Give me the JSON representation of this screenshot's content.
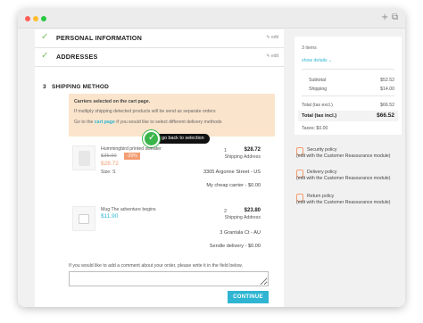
{
  "window": {
    "plus_icon": "+",
    "copy_icon": "⧉"
  },
  "steps": [
    {
      "title": "PERSONAL INFORMATION",
      "edit": "✎ edit"
    },
    {
      "title": "ADDRESSES",
      "edit": "✎ edit"
    }
  ],
  "shipping": {
    "number": "3",
    "title": "SHIPPING METHOD",
    "notice": {
      "heading": "Carriers selected on the cart page.",
      "line2": "If multiply shipping detected products will be send as separate orders",
      "line3_prefix": "Go to the ",
      "line3_link": "cart page",
      "line3_suffix": " if you would like to select different delivery methods"
    },
    "tooltip": "go back to selection"
  },
  "products": [
    {
      "name": "Hummingbird printed sweater",
      "old_price": "$35.90",
      "discount": "-20%",
      "price": "$28.72",
      "size": "Size: S",
      "qty": "1",
      "total": "$28.72",
      "address_label": "Shipping Address",
      "street": "3305 Argonne Street - US",
      "carrier": "My cheap carrier - $0.00"
    },
    {
      "name": "Mug The adventure begins",
      "price": "$11.90",
      "qty": "2",
      "total": "$23.80",
      "address_label": "Shipping Address",
      "street": "3 Grantala Ct - AU",
      "carrier": "Sendle delivery - $0.00"
    }
  ],
  "comment": {
    "label": "If you would like to add a comment about your order, please write it in the field below.",
    "value": ""
  },
  "continue_label": "CONTINUE",
  "summary": {
    "items": "3 items",
    "show_details": "show details ⌄",
    "subtotal_label": "Subtotal",
    "subtotal": "$52.52",
    "shipping_label": "Shipping",
    "shipping": "$14.00",
    "total_excl_label": "Total (tax excl.)",
    "total_excl": "$66.52",
    "total_incl_label": "Total (tax incl.)",
    "total_incl": "$66.52",
    "taxes": "Taxes: $0.00"
  },
  "reassurance": [
    {
      "title": "Security policy",
      "sub": "(edit with the Customer Reassurance module)"
    },
    {
      "title": "Delivery policy",
      "sub": "(edit with the Customer Reassurance module)"
    },
    {
      "title": "Return policy",
      "sub": "(edit with the Customer Reassurance module)"
    }
  ],
  "colors": {
    "accent": "#2fb5d2",
    "discount": "#f39d72",
    "notice_bg": "#fbe4cc",
    "check": "#7cc05e"
  }
}
